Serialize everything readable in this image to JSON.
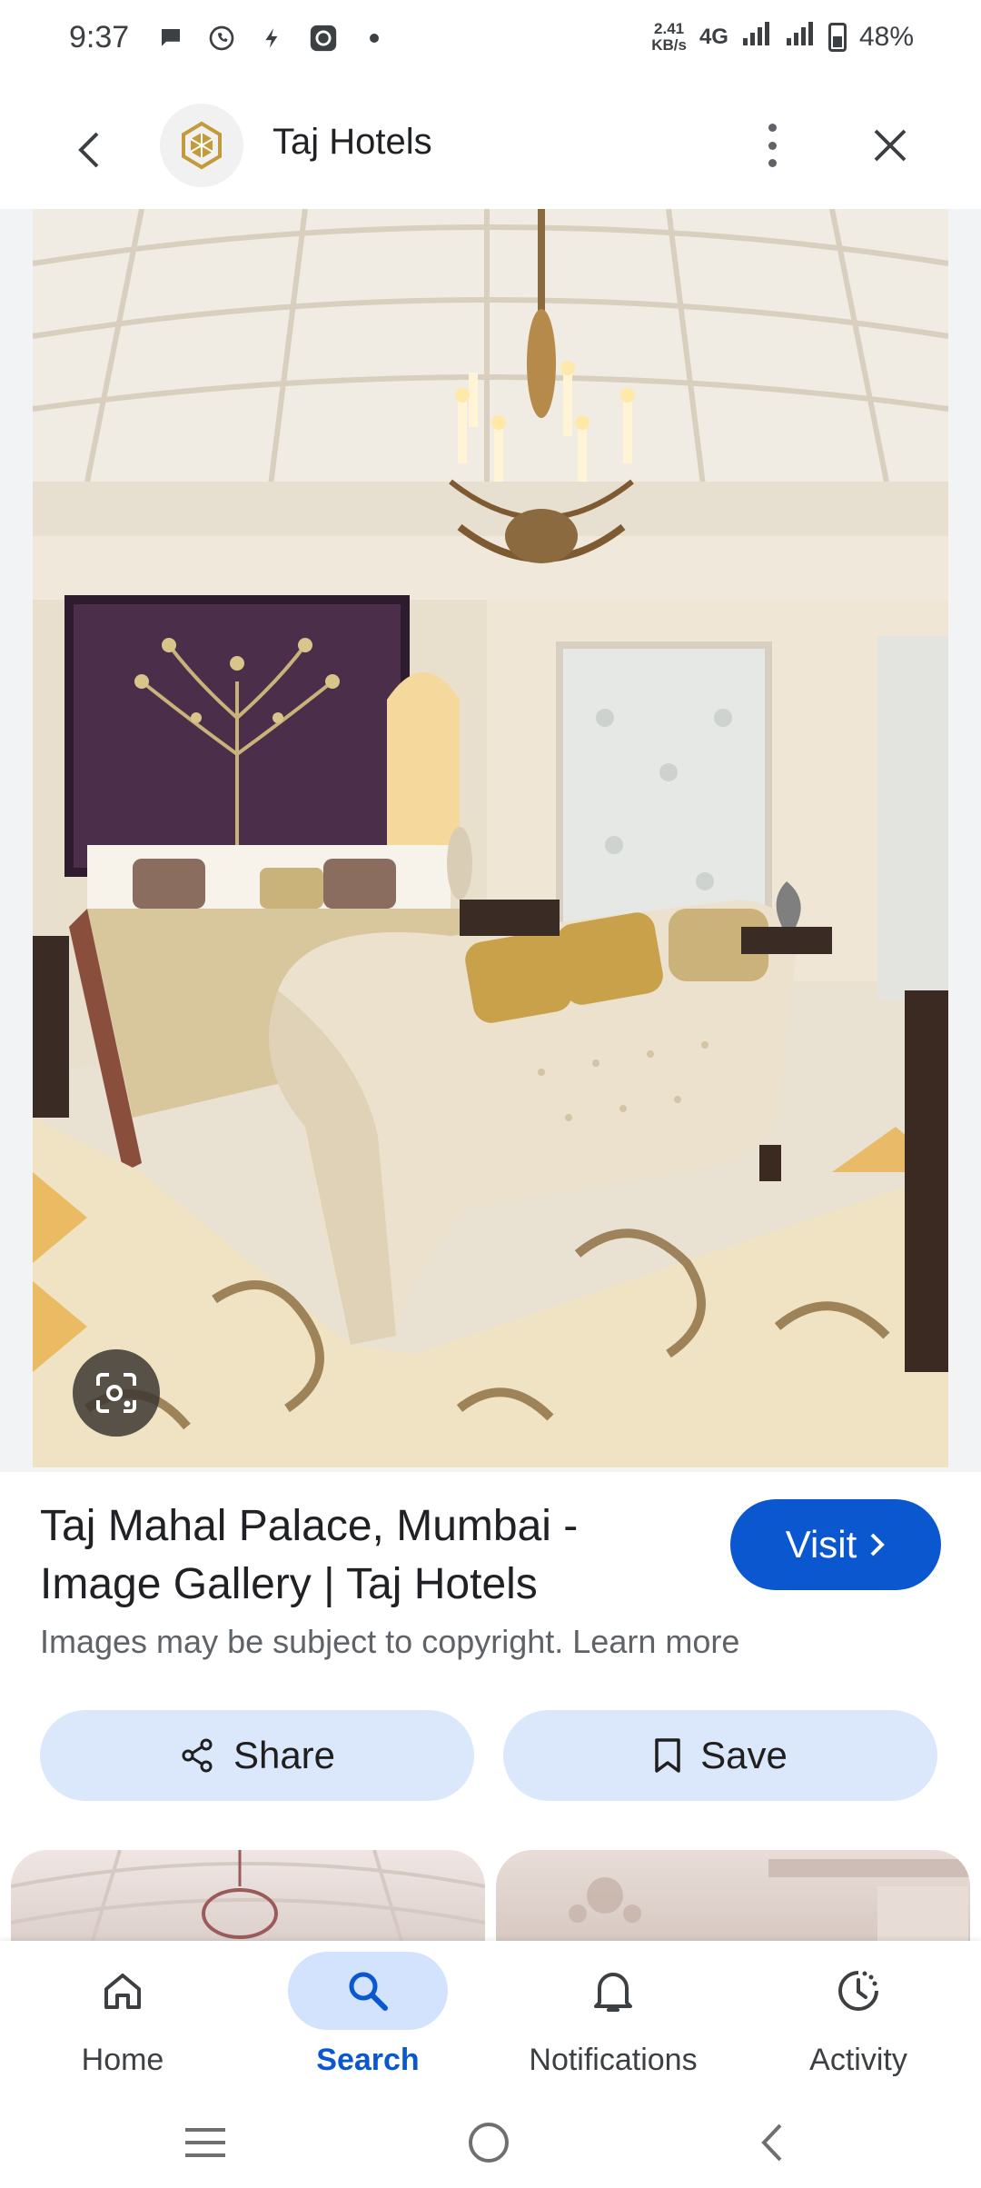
{
  "status_bar": {
    "time": "9:37",
    "speed_value": "2.41",
    "speed_unit": "KB/s",
    "network": "4G",
    "battery": "48%"
  },
  "app_bar": {
    "title": "Taj Hotels"
  },
  "result": {
    "title": "Taj Mahal Palace, Mumbai - Image Gallery | Taj Hotels",
    "visit_label": "Visit",
    "copyright": "Images may be subject to copyright. Learn more"
  },
  "actions": {
    "share_label": "Share",
    "save_label": "Save"
  },
  "bottom_nav": {
    "items": [
      {
        "label": "Home",
        "icon": "home-icon"
      },
      {
        "label": "Search",
        "icon": "search-icon"
      },
      {
        "label": "Notifications",
        "icon": "bell-icon"
      },
      {
        "label": "Activity",
        "icon": "activity-icon"
      }
    ],
    "active": "Search"
  },
  "colors": {
    "accent": "#0b57d0",
    "pill_bg": "#dbe8fb",
    "active_nav_bg": "#d3e3fd"
  }
}
